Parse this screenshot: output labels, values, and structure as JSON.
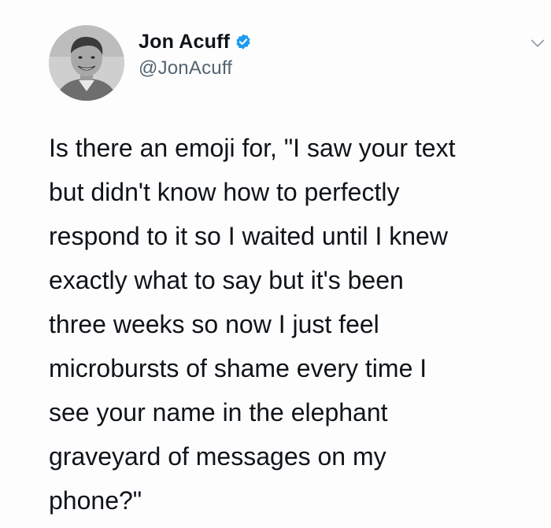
{
  "author": {
    "display_name": "Jon Acuff",
    "handle": "@JonAcuff",
    "verified": true,
    "verified_color": "#1d9bf0"
  },
  "icons": {
    "verified": "verified-badge-icon",
    "menu": "chevron-down-icon"
  },
  "tweet": {
    "text": "Is there an emoji for, \"I saw your text\nbut didn't know how to perfectly\nrespond to it so I waited until I knew\nexactly what to say but it's been\nthree weeks so now I just feel\nmicrobursts of shame every time I\nsee your name in the elephant\ngraveyard of messages on my\nphone?\""
  }
}
